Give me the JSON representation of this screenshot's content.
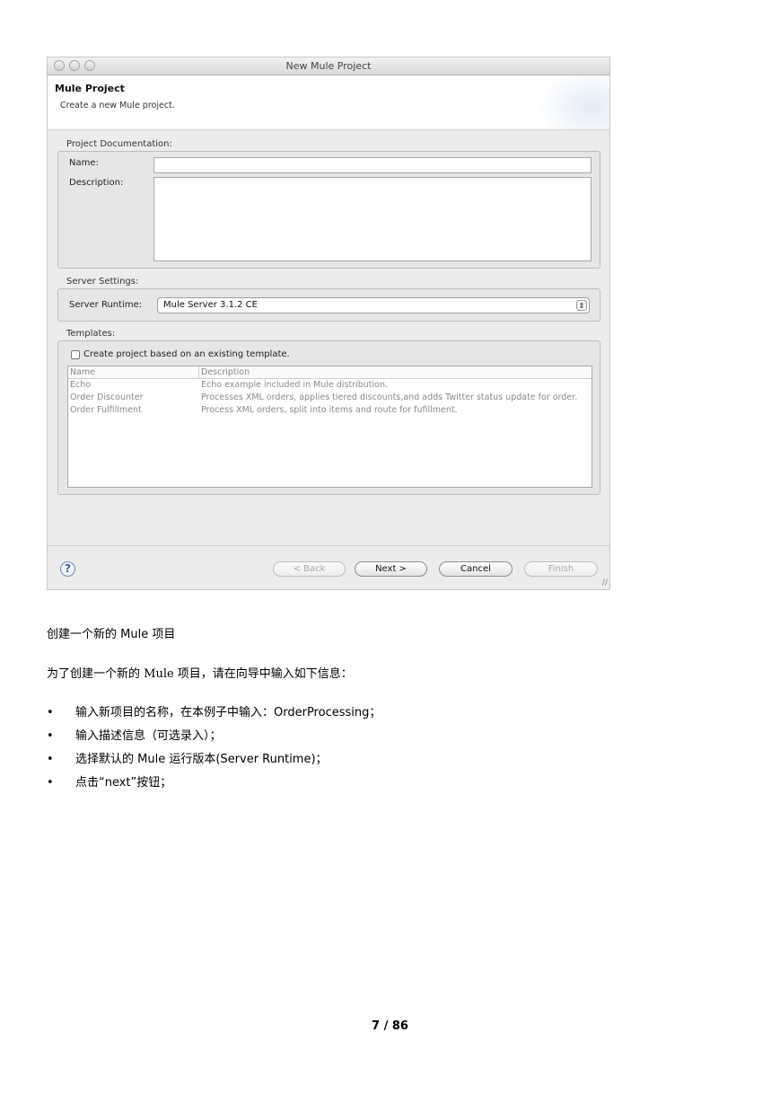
{
  "dialog": {
    "window_title": "New Mule Project",
    "banner_title": "Mule Project",
    "banner_subtitle": "Create a new Mule project.",
    "project_doc": {
      "group_label": "Project Documentation:",
      "name_label": "Name:",
      "name_value": "",
      "description_label": "Description:",
      "description_value": ""
    },
    "server": {
      "group_label": "Server Settings:",
      "runtime_label": "Server Runtime:",
      "runtime_value": "Mule Server 3.1.2 CE"
    },
    "templates": {
      "group_label": "Templates:",
      "checkbox_label": "Create project based on an existing template.",
      "checked": false,
      "columns": [
        "Name",
        "Description"
      ],
      "rows": [
        {
          "name": "Echo",
          "description": "Echo example included in Mule distribution."
        },
        {
          "name": "Order Discounter",
          "description": "Processes XML orders, applies tiered discounts,and adds Twitter status update for order."
        },
        {
          "name": "Order Fulfillment",
          "description": "Process XML orders, split into items and route for fufillment."
        }
      ]
    },
    "buttons": {
      "help": "?",
      "back": "< Back",
      "next": "Next >",
      "cancel": "Cancel",
      "finish": "Finish"
    }
  },
  "document": {
    "heading": "创建一个新的 Mule 项目",
    "intro": "为了创建一个新的 Mule 项目，请在向导中输入如下信息：",
    "bullets": [
      "输入新项目的名称，在本例子中输入：OrderProcessing；",
      "输入描述信息（可选录入）；",
      "选择默认的 Mule 运行版本(Server Runtime)；",
      "点击“next”按钮；"
    ],
    "bullet_symbol": "•",
    "page_number": "7 / 86"
  }
}
